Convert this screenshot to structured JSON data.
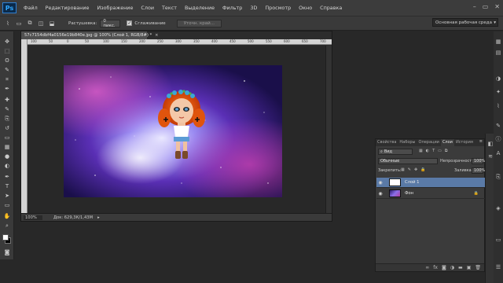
{
  "app": {
    "logo": "Ps",
    "menu": [
      "Файл",
      "Редактирование",
      "Изображение",
      "Слои",
      "Текст",
      "Выделение",
      "Фильтр",
      "3D",
      "Просмотр",
      "Окно",
      "Справка"
    ],
    "window_controls": [
      "–",
      "▭",
      "✕"
    ]
  },
  "options_bar": {
    "feather_label": "Растушевка:",
    "feather_value": "0 пикс.",
    "antialias_label": "Сглаживание",
    "antialias_checked": true,
    "refine_edge_label": "Уточн. край...",
    "workspace_label": "Основная рабочая среда"
  },
  "toolbar": {
    "icons": [
      "move-icon",
      "marquee-icon",
      "lasso-icon",
      "quick-select-icon",
      "crop-icon",
      "eyedropper-icon",
      "healing-icon",
      "brush-icon",
      "stamp-icon",
      "history-brush-icon",
      "eraser-icon",
      "gradient-icon",
      "blur-icon",
      "dodge-icon",
      "pen-icon",
      "type-icon",
      "path-select-icon",
      "shape-icon",
      "hand-icon",
      "zoom-icon"
    ],
    "glyphs": [
      "✥",
      "⬚",
      "ʘ",
      "✎",
      "⌗",
      "✒",
      "✚",
      "✎",
      "⎘",
      "↺",
      "▭",
      "▦",
      "●",
      "◐",
      "✒",
      "T",
      "➤",
      "▭",
      "✋",
      "⌕"
    ],
    "foreground_color": "#ffffff",
    "background_color": "#000000"
  },
  "document": {
    "tab_title": "57c7154dbf4a0156e19b840e.jpg @ 100% (Слой 1, RGB/8#) *",
    "zoom": "100%",
    "doc_size": "Док: 629,3К/1,43М",
    "ruler_ticks": [
      "100",
      "50",
      "0",
      "50",
      "100",
      "150",
      "200",
      "250",
      "300",
      "350",
      "400",
      "450",
      "500",
      "550",
      "600",
      "650",
      "700"
    ]
  },
  "layers_panel": {
    "tabs": [
      "Свойства",
      "Наборы",
      "Операции",
      "Слои",
      "История"
    ],
    "active_tab": "Слои",
    "filter_kind": "Вид",
    "blend_mode": "Обычные",
    "opacity_label": "Непрозрачность:",
    "opacity_value": "100%",
    "lock_label": "Закрепить:",
    "fill_label": "Заливка:",
    "fill_value": "100%",
    "layers": [
      {
        "name": "Слой 1",
        "visible": true,
        "selected": true
      },
      {
        "name": "Фон",
        "visible": true,
        "selected": false,
        "locked": true
      }
    ],
    "footer_icons": [
      "link-icon",
      "fx-icon",
      "mask-icon",
      "adjustment-icon",
      "folder-icon",
      "new-layer-icon",
      "trash-icon"
    ],
    "footer_glyphs": [
      "∞",
      "fx",
      "◙",
      "◑",
      "▬",
      "▣",
      "🗑"
    ]
  },
  "colors": {
    "selection_highlight": "#5a7aa7",
    "accent": "#31a8ff"
  }
}
